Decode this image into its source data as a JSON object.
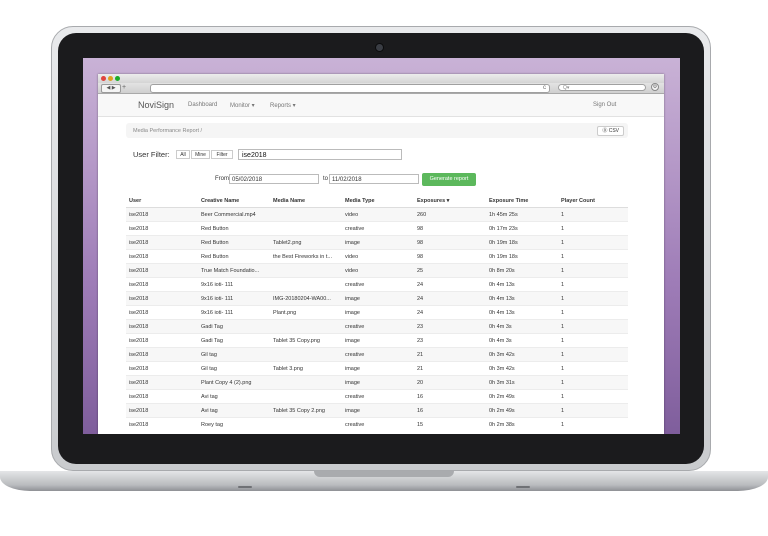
{
  "browser": {
    "nav_buttons": "◀ ▶",
    "new_tab": "+",
    "reload": "c",
    "search_placeholder": "Q▾",
    "settings_glyph": "⚙",
    "traffic_colors": [
      "#e0443e",
      "#dea123",
      "#1aab29"
    ]
  },
  "app": {
    "brand": "NoviSign",
    "nav": [
      "Dashboard",
      "Monitor ▾",
      "Reports ▾"
    ],
    "signout": "Sign Out",
    "breadcrumb": "Media Performance Report  /",
    "csv_label": "CSV",
    "csv_icon": "⓪"
  },
  "filter": {
    "label": "User Filter:",
    "buttons": [
      "All",
      "Mine",
      "Filter"
    ],
    "value": "ise2018"
  },
  "dates": {
    "from_label": "From",
    "from_value": "05/02/2018",
    "to_label": "to",
    "to_value": "11/02/2018",
    "generate_label": "Generate report",
    "generate_color": "#5cb85c"
  },
  "table": {
    "columns": [
      "User",
      "Creative Name",
      "Media Name",
      "Media Type",
      "Exposures ▾",
      "Exposure Time",
      "Player Count"
    ],
    "rows": [
      [
        "ise2018",
        "Beer Commercial.mp4",
        "",
        "video",
        "260",
        "1h 45m 25s",
        "1"
      ],
      [
        "ise2018",
        "Red Button",
        "",
        "creative",
        "98",
        "0h 17m 23s",
        "1"
      ],
      [
        "ise2018",
        "Red Button",
        "Tablet2.png",
        "image",
        "98",
        "0h 19m 18s",
        "1"
      ],
      [
        "ise2018",
        "Red Button",
        "the Best Fireworks in t...",
        "video",
        "98",
        "0h 19m 18s",
        "1"
      ],
      [
        "ise2018",
        "True Match Foundatio...",
        "",
        "video",
        "25",
        "0h 8m 20s",
        "1"
      ],
      [
        "ise2018",
        "9x16 ioti- 111",
        "",
        "creative",
        "24",
        "0h 4m 13s",
        "1"
      ],
      [
        "ise2018",
        "9x16 ioti- 111",
        "IMG-20180204-WA00...",
        "image",
        "24",
        "0h 4m 13s",
        "1"
      ],
      [
        "ise2018",
        "9x16 ioti- 111",
        "Plant.png",
        "image",
        "24",
        "0h 4m 13s",
        "1"
      ],
      [
        "ise2018",
        "Gadi Tag",
        "",
        "creative",
        "23",
        "0h 4m 3s",
        "1"
      ],
      [
        "ise2018",
        "Gadi Tag",
        "Tablet 35 Copy.png",
        "image",
        "23",
        "0h 4m 3s",
        "1"
      ],
      [
        "ise2018",
        "Gil tag",
        "",
        "creative",
        "21",
        "0h 3m 42s",
        "1"
      ],
      [
        "ise2018",
        "Gil tag",
        "Tablet 3.png",
        "image",
        "21",
        "0h 3m 42s",
        "1"
      ],
      [
        "ise2018",
        "Plant Copy 4 (2).png",
        "",
        "image",
        "20",
        "0h 3m 31s",
        "1"
      ],
      [
        "ise2018",
        "Avi tag",
        "",
        "creative",
        "16",
        "0h 2m 49s",
        "1"
      ],
      [
        "ise2018",
        "Avi tag",
        "Tablet 35 Copy 2.png",
        "image",
        "16",
        "0h 2m 49s",
        "1"
      ],
      [
        "ise2018",
        "Roey tag",
        "",
        "creative",
        "15",
        "0h 2m 38s",
        "1"
      ]
    ]
  }
}
